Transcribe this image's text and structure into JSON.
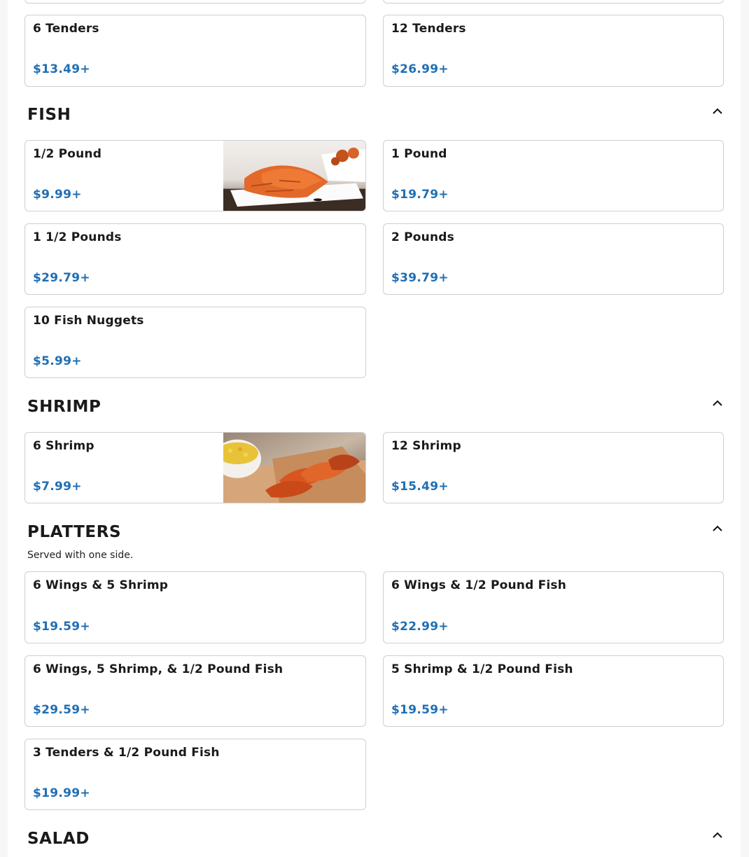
{
  "colors": {
    "price": "#1f6fb5",
    "card_border": "#cfcfcf",
    "text": "#1a1a1a"
  },
  "tenders_partial": {
    "items": [
      {
        "name": "6 Tenders",
        "price": "$13.49+"
      },
      {
        "name": "12 Tenders",
        "price": "$26.99+"
      }
    ]
  },
  "fish": {
    "title": "FISH",
    "collapse_icon": "chevron-up-icon",
    "items": [
      {
        "name": "1/2 Pound",
        "price": "$9.99+",
        "image": "fried-fish-photo"
      },
      {
        "name": "1 Pound",
        "price": "$19.79+"
      },
      {
        "name": "1 1/2 Pounds",
        "price": "$29.79+"
      },
      {
        "name": "2 Pounds",
        "price": "$39.79+"
      },
      {
        "name": "10 Fish Nuggets",
        "price": "$5.99+"
      }
    ]
  },
  "shrimp": {
    "title": "SHRIMP",
    "collapse_icon": "chevron-up-icon",
    "items": [
      {
        "name": "6 Shrimp",
        "price": "$7.99+",
        "image": "fried-shrimp-photo"
      },
      {
        "name": "12 Shrimp",
        "price": "$15.49+"
      }
    ]
  },
  "platters": {
    "title": "PLATTERS",
    "description": "Served with one side.",
    "collapse_icon": "chevron-up-icon",
    "items": [
      {
        "name": "6 Wings & 5 Shrimp",
        "price": "$19.59+"
      },
      {
        "name": "6 Wings & 1/2 Pound Fish",
        "price": "$22.99+"
      },
      {
        "name": "6 Wings, 5 Shrimp, & 1/2 Pound Fish",
        "price": "$29.59+"
      },
      {
        "name": "5 Shrimp & 1/2 Pound Fish",
        "price": "$19.59+"
      },
      {
        "name": "3 Tenders & 1/2 Pound Fish",
        "price": "$19.99+"
      }
    ]
  },
  "salad": {
    "title": "SALAD",
    "collapse_icon": "chevron-up-icon"
  }
}
